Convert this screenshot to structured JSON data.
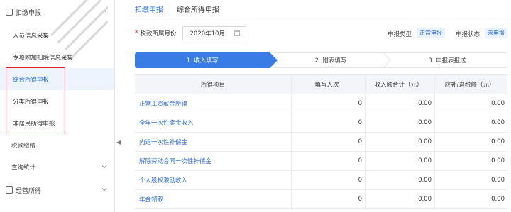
{
  "sidebar": {
    "groups": [
      {
        "label": "扣缴申报"
      },
      {
        "label": "经营所得"
      }
    ],
    "items": [
      {
        "label": "人员信息采集"
      },
      {
        "label": "专项附加扣除信息采集"
      },
      {
        "label": "综合所得申报"
      },
      {
        "label": "分类所得申报"
      },
      {
        "label": "非居民所得申报"
      },
      {
        "label": "税款缴纳"
      },
      {
        "label": "查询统计"
      }
    ],
    "colors": {
      "active": "#2d6fd6",
      "highlight_border": "#e22222"
    }
  },
  "breadcrumb": {
    "parent": "扣缴申报",
    "current": "综合所得申报"
  },
  "filter": {
    "required_mark": "*",
    "period_label": "税款所属月份",
    "period_value": "2020年10月",
    "type_label": "申报类型",
    "type_value": "正常申报",
    "status_label": "申报状态",
    "status_value": "未申报"
  },
  "steps": [
    {
      "label": "1. 收入填写"
    },
    {
      "label": "2. 附表填写"
    },
    {
      "label": "3. 申报表报送"
    }
  ],
  "table": {
    "headers": [
      "所得项目",
      "填写人次",
      "收入额合计（元）",
      "应补/退税额（元）"
    ],
    "rows": [
      {
        "item": "正常工资薪金所得",
        "count": "0",
        "income": "0.00",
        "tax": "0.00"
      },
      {
        "item": "全年一次性奖金收入",
        "count": "0",
        "income": "0.00",
        "tax": "0.00"
      },
      {
        "item": "内退一次性补偿金",
        "count": "0",
        "income": "0.00",
        "tax": "0.00"
      },
      {
        "item": "解除劳动合同一次性补偿金",
        "count": "0",
        "income": "0.00",
        "tax": "0.00"
      },
      {
        "item": "个人股权激励收入",
        "count": "0",
        "income": "0.00",
        "tax": "0.00"
      },
      {
        "item": "年金领取",
        "count": "0",
        "income": "0.00",
        "tax": "0.00"
      }
    ]
  },
  "accent_color": "#3a7ce6"
}
